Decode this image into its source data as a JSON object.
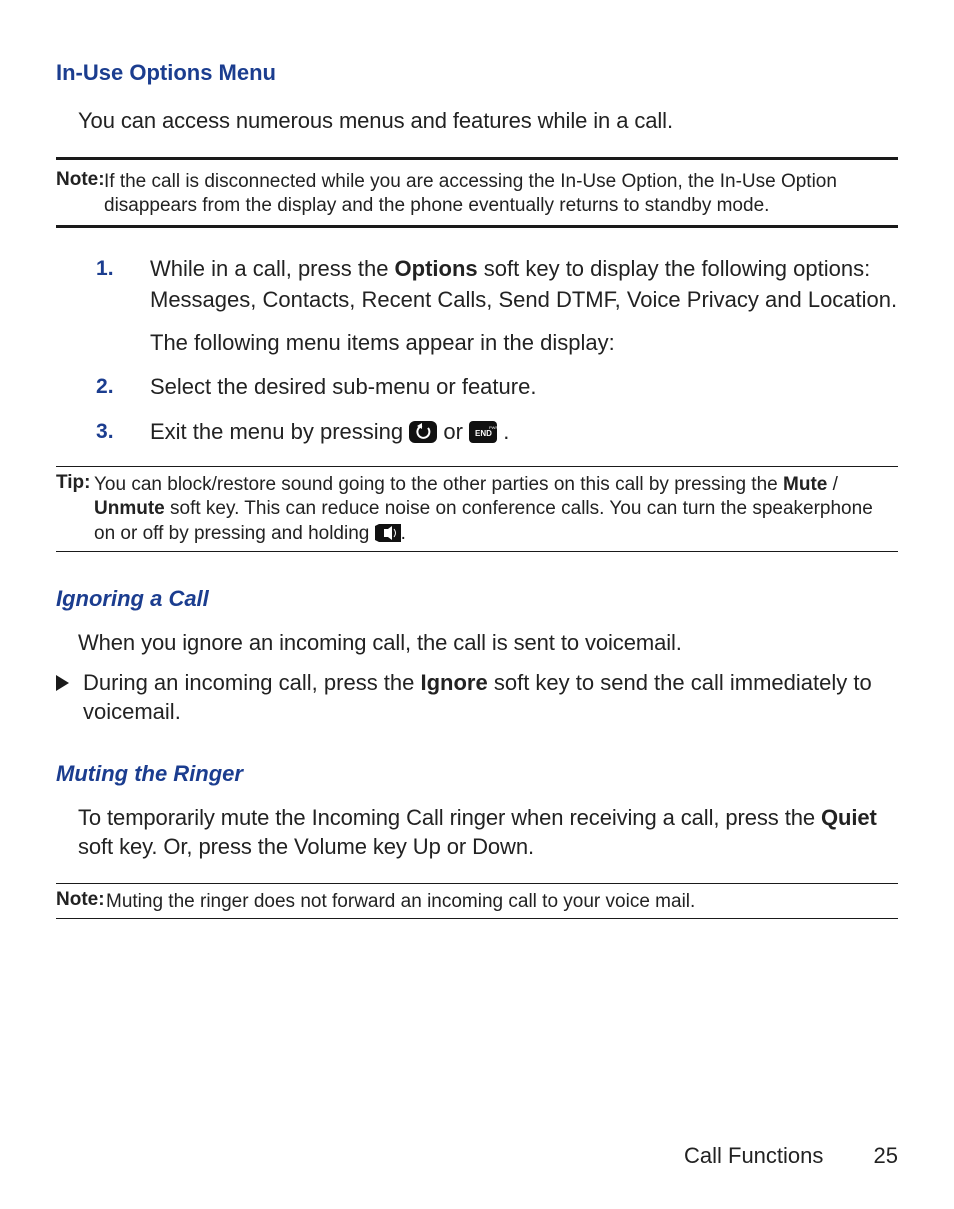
{
  "headings": {
    "in_use": "In-Use Options Menu",
    "ignoring": "Ignoring a Call",
    "muting": "Muting the Ringer"
  },
  "intro": "You can access numerous menus and features while in a call.",
  "note1": {
    "label": "Note:",
    "text": "If the call is disconnected while you are accessing the In-Use Option, the In-Use Option disappears from the display and the phone eventually returns to standby mode."
  },
  "steps": {
    "s1a": "While in a call, press the ",
    "s1_options": "Options",
    "s1b": " soft key to display the following options: Messages, Contacts, Recent Calls, Send DTMF, Voice Privacy and Location.",
    "s1c": "The following menu items appear in the display:",
    "s2": "Select the desired sub-menu or feature.",
    "s3a": "Exit the menu by pressing ",
    "s3_or": " or ",
    "s3_end": "."
  },
  "tip": {
    "label": "Tip:",
    "text_a": "You can block/restore sound going to the other parties on this call by pressing the ",
    "mute": "Mute",
    "slash": " / ",
    "unmute": "Unmute",
    "text_b": " soft key. This can reduce noise on conference calls. You can turn the speakerphone on or off by pressing and holding ",
    "text_c": "."
  },
  "ignoring": {
    "intro": "When you ignore an incoming call, the call is sent to voicemail.",
    "bullet_a": "During an incoming call, press the ",
    "ignore": "Ignore",
    "bullet_b": " soft key to send the call immediately to voicemail."
  },
  "muting": {
    "text_a": "To temporarily mute the Incoming Call ringer when receiving a call, press the ",
    "quiet": "Quiet",
    "text_b": " soft key. Or, press the Volume key Up or Down."
  },
  "note2": {
    "label": "Note:",
    "text": "Muting the ringer does not forward an incoming call to your voice mail."
  },
  "footer": {
    "section": "Call Functions",
    "page": "25"
  }
}
